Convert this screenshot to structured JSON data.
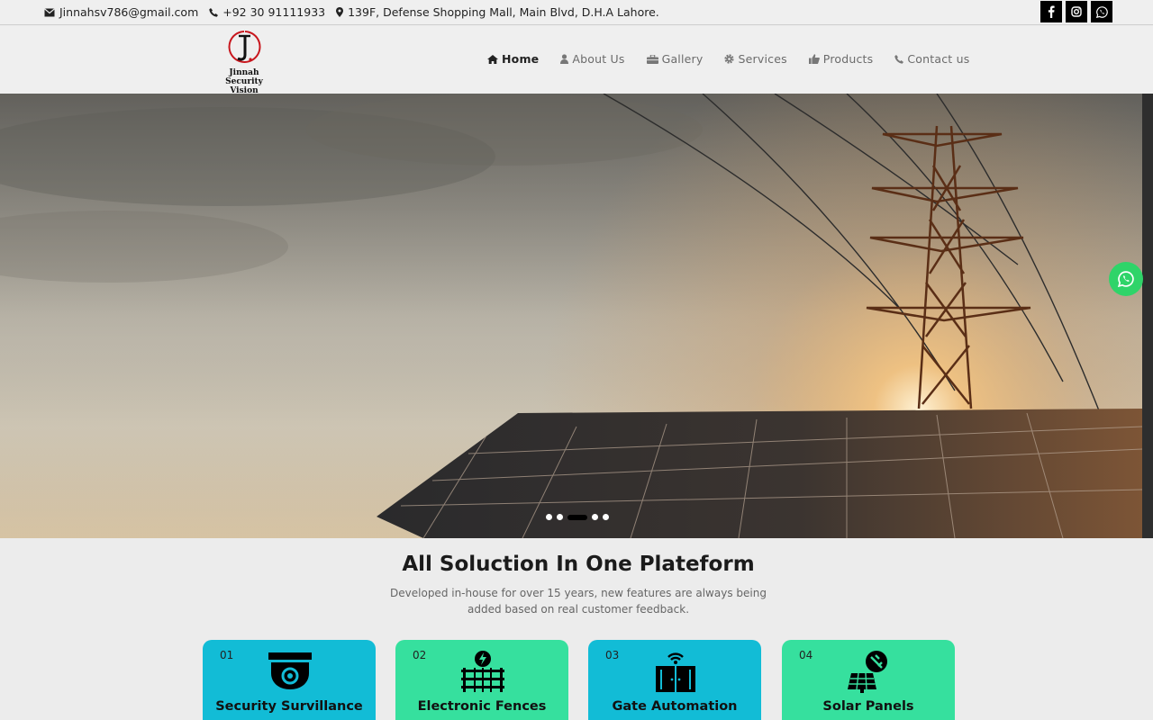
{
  "topbar": {
    "email": "Jinnahsv786@gmail.com",
    "phone": "+92 30 91111933",
    "address": "139F, Defense Shopping Mall, Main Blvd, D.H.A Lahore."
  },
  "logo": {
    "line1": "Jinnah Security",
    "line2": "Vision"
  },
  "nav": {
    "items": [
      {
        "label": "Home",
        "icon": "home-icon",
        "active": true
      },
      {
        "label": "About Us",
        "icon": "user-icon"
      },
      {
        "label": "Gallery",
        "icon": "briefcase-icon"
      },
      {
        "label": "Services",
        "icon": "gear-icon"
      },
      {
        "label": "Products",
        "icon": "thumbs-up-icon"
      },
      {
        "label": "Contact us",
        "icon": "phone-icon"
      }
    ]
  },
  "hero": {
    "slide_count": 5,
    "active_slide": 3
  },
  "section": {
    "title": "All Soluction In One Plateform",
    "subtitle": "Developed in-house for over 15 years, new features are always being added based on real customer feedback."
  },
  "cards": [
    {
      "num": "01",
      "title": "Security Survillance",
      "icon": "cctv-camera-icon",
      "color": "#12bcd6"
    },
    {
      "num": "02",
      "title": "Electronic Fences",
      "icon": "electric-fence-icon",
      "color": "#36e09e"
    },
    {
      "num": "03",
      "title": "Gate Automation",
      "icon": "automatic-gate-icon",
      "color": "#12bcd6"
    },
    {
      "num": "04",
      "title": "Solar Panels",
      "icon": "solar-panel-icon",
      "color": "#36e09e"
    }
  ],
  "colors": {
    "social_bg": "#000000",
    "whatsapp": "#2fd469"
  }
}
